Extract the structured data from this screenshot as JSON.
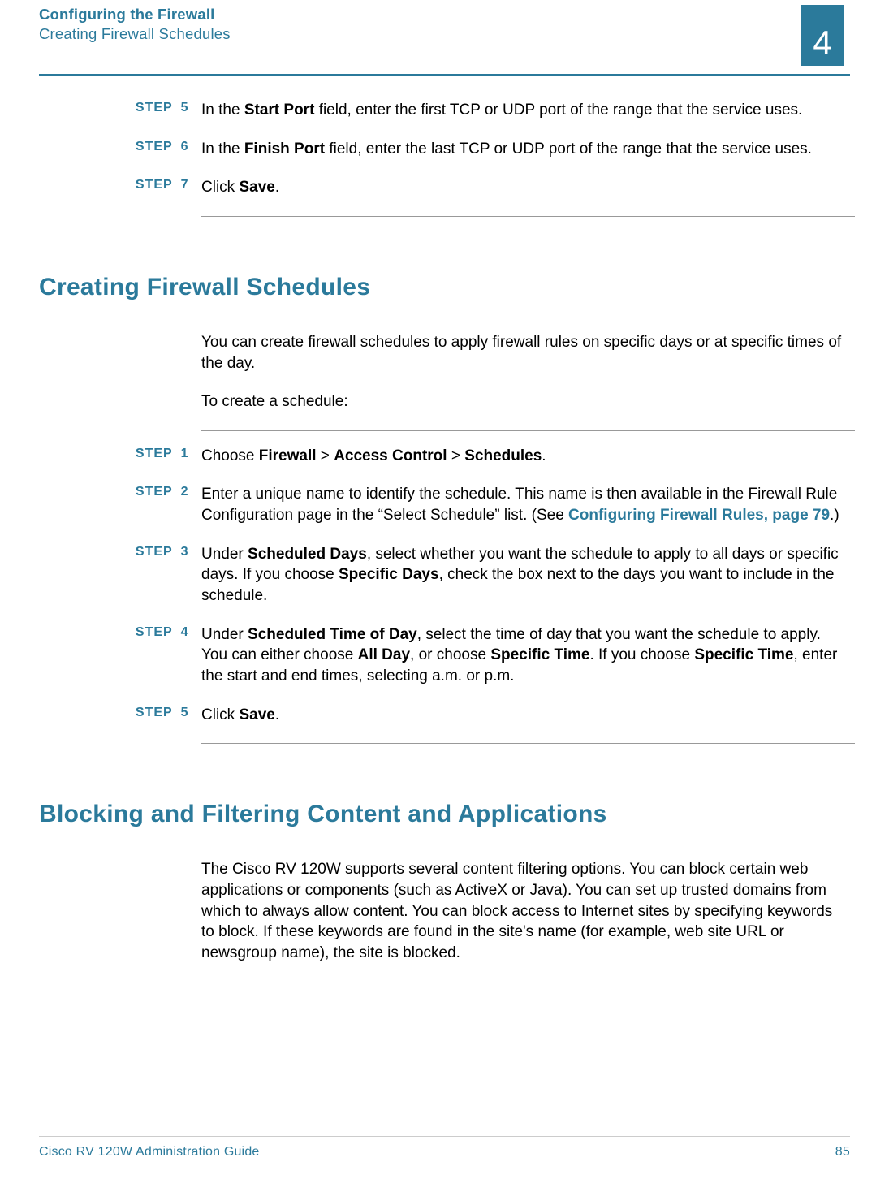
{
  "header": {
    "title": "Configuring the Firewall",
    "subtitle": "Creating Firewall Schedules",
    "chapter_number": "4"
  },
  "top_steps": [
    {
      "num": "5",
      "text_pre": "In the ",
      "bold1": "Start Port",
      "text_post": " field, enter the first TCP or UDP port of the range that the service uses."
    },
    {
      "num": "6",
      "text_pre": "In the ",
      "bold1": "Finish Port",
      "text_post": " field, enter the last TCP or UDP port of the range that the service uses."
    },
    {
      "num": "7",
      "text_pre": "Click ",
      "bold1": "Save",
      "text_post": "."
    }
  ],
  "section1": {
    "title": "Creating Firewall Schedules",
    "intro1": "You can create firewall schedules to apply firewall rules on specific days or at specific times of the day.",
    "intro2": "To create a schedule:"
  },
  "steps1": {
    "s1": {
      "num": "1",
      "pre": "Choose ",
      "b1": "Firewall",
      "sep1": " > ",
      "b2": "Access Control",
      "sep2": " > ",
      "b3": "Schedules",
      "post": "."
    },
    "s2": {
      "num": "2",
      "pre": "Enter a unique name to identify the schedule. This name is then available in the Firewall Rule Configuration page in the “Select Schedule” list. (See ",
      "link": "Configuring Firewall Rules, page 79",
      "post": ".)"
    },
    "s3": {
      "num": "3",
      "pre": "Under ",
      "b1": "Scheduled Days",
      "mid": ", select whether you want the schedule to apply to all days or specific days. If you choose ",
      "b2": "Specific Days",
      "post": ", check the box next to the days you want to include in the schedule."
    },
    "s4": {
      "num": "4",
      "pre": "Under ",
      "b1": "Scheduled Time of Day",
      "mid1": ", select the time of day that you want the schedule to apply. You can either choose ",
      "b2": "All Day",
      "mid2": ", or choose ",
      "b3": "Specific Time",
      "mid3": ". If you choose ",
      "b4": "Specific Time",
      "post": ", enter the start and end times, selecting a.m. or p.m."
    },
    "s5": {
      "num": "5",
      "pre": "Click ",
      "b1": "Save",
      "post": "."
    }
  },
  "section2": {
    "title": "Blocking and Filtering Content and Applications",
    "para": "The Cisco RV 120W supports several content filtering options. You can block certain web applications or components (such as ActiveX or Java). You can set up trusted domains from which to always allow content. You can block access to Internet sites by specifying keywords to block. If these keywords are found in the site's name (for example, web site URL or newsgroup name), the site is blocked."
  },
  "footer": {
    "left": "Cisco RV 120W Administration Guide",
    "right": "85"
  },
  "labels": {
    "step_word": "STEP"
  }
}
